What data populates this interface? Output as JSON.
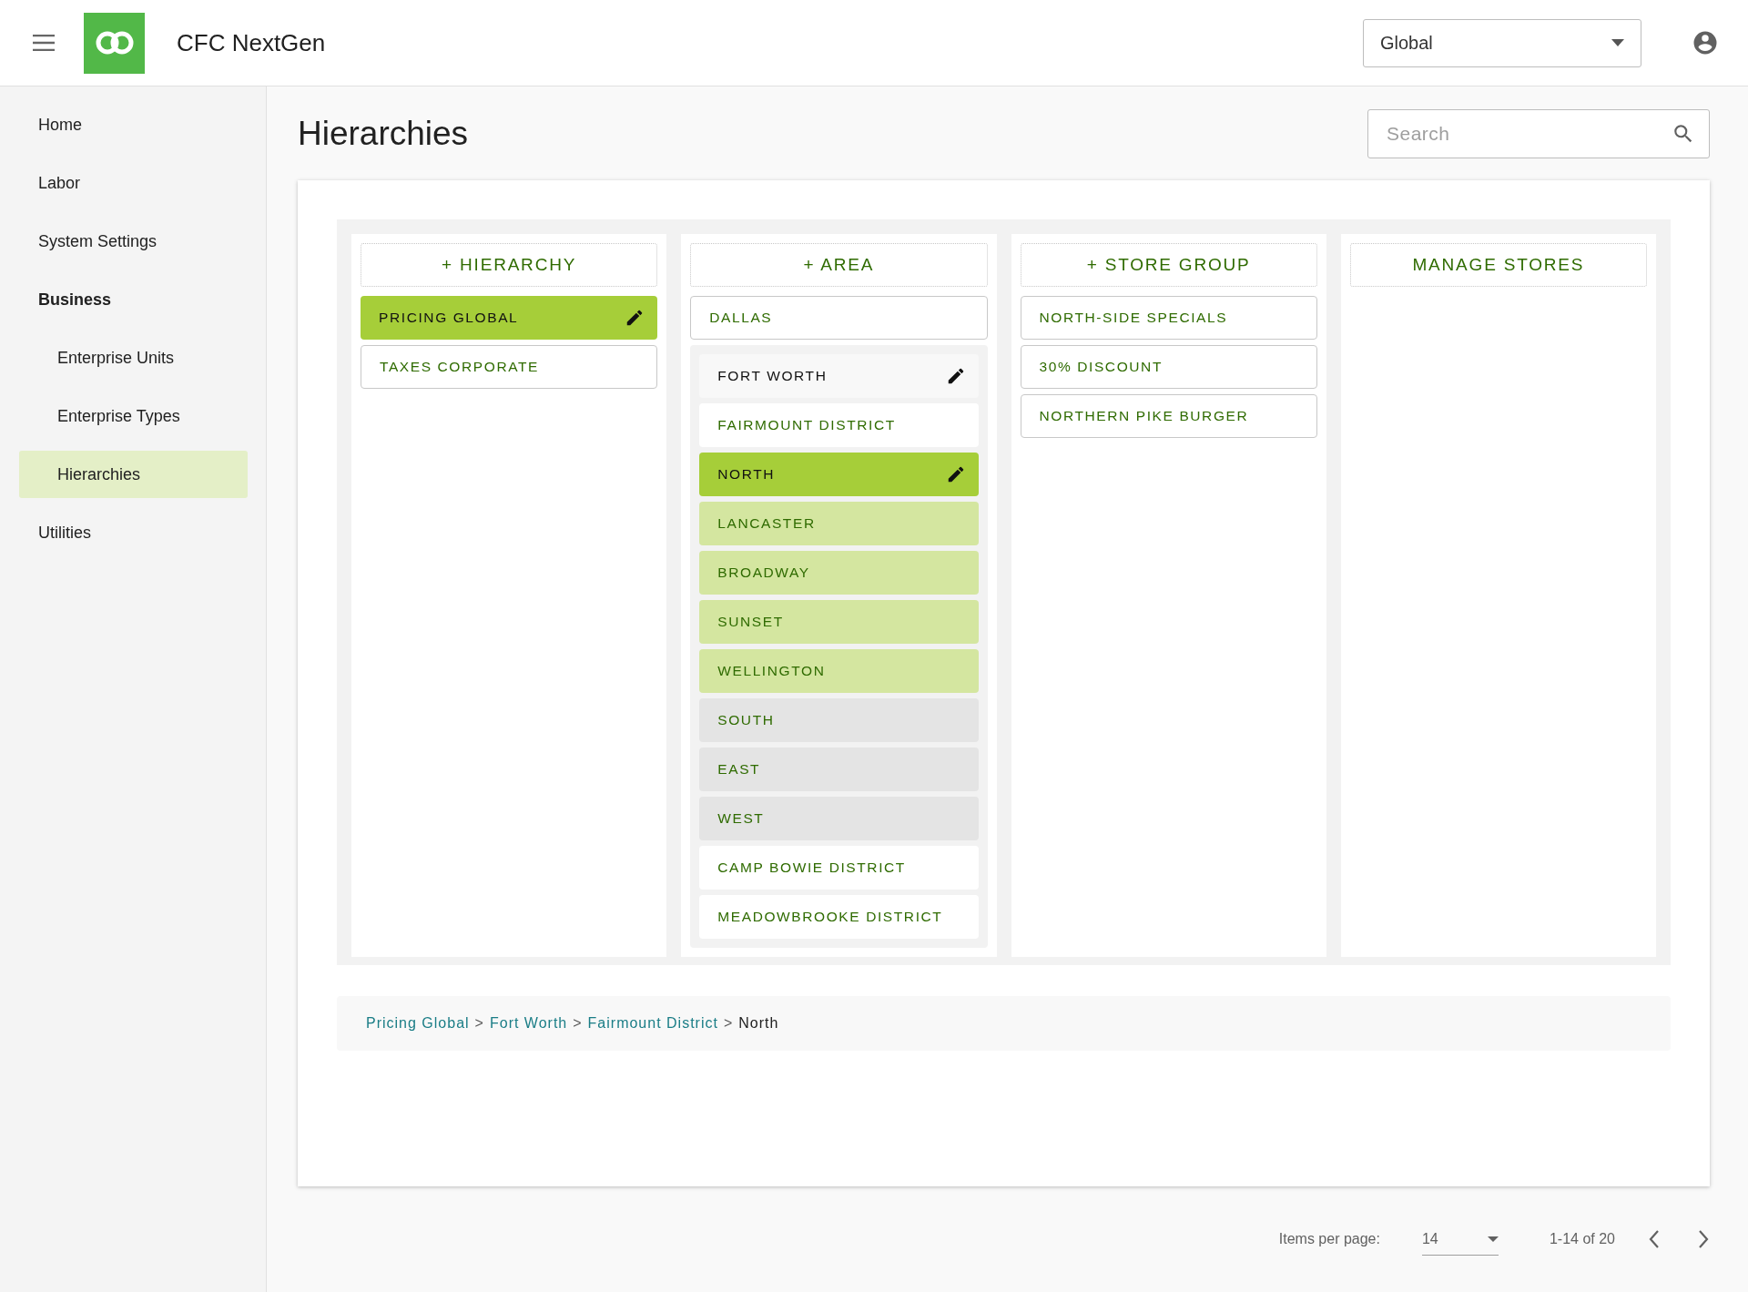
{
  "header": {
    "title": "CFC NextGen",
    "scope_select": {
      "value": "Global"
    }
  },
  "sidebar": {
    "items": [
      {
        "label": "Home",
        "selected": false
      },
      {
        "label": "Labor",
        "selected": false
      },
      {
        "label": "System Settings",
        "selected": false
      },
      {
        "label": "Business",
        "selected": false,
        "children": [
          {
            "label": "Enterprise Units",
            "selected": false
          },
          {
            "label": "Enterprise Types",
            "selected": false
          },
          {
            "label": "Hierarchies",
            "selected": true
          }
        ]
      },
      {
        "label": "Utilities",
        "selected": false
      }
    ]
  },
  "page": {
    "title": "Hierarchies",
    "search": {
      "placeholder": "Search"
    }
  },
  "columns": [
    {
      "header": "+ HIERARCHY",
      "items": [
        {
          "label": "PRICING GLOBAL",
          "selected": true
        },
        {
          "label": "TAXES CORPORATE",
          "selected": false
        }
      ]
    },
    {
      "header": "+ AREA",
      "items": [
        {
          "label": "DALLAS",
          "selected": false
        },
        {
          "label": "FORT WORTH",
          "selected": false,
          "expanded": true,
          "children": [
            {
              "label": "FAIRMOUNT DISTRICT",
              "selected": false,
              "expanded": true,
              "children": [
                {
                  "label": "NORTH",
                  "selected": true,
                  "expanded": true,
                  "children": [
                    {
                      "label": "LANCASTER",
                      "selected": false
                    },
                    {
                      "label": "BROADWAY",
                      "selected": false
                    },
                    {
                      "label": "SUNSET",
                      "selected": false
                    },
                    {
                      "label": "WELLINGTON",
                      "selected": false
                    }
                  ]
                },
                {
                  "label": "SOUTH",
                  "selected": false
                },
                {
                  "label": "EAST",
                  "selected": false
                },
                {
                  "label": "WEST",
                  "selected": false
                }
              ]
            },
            {
              "label": "CAMP BOWIE DISTRICT",
              "selected": false
            },
            {
              "label": "MEADOWBROOKE DISTRICT",
              "selected": false
            }
          ]
        }
      ]
    },
    {
      "header": "+ STORE GROUP",
      "items": [
        {
          "label": "NORTH-SIDE SPECIALS",
          "selected": false
        },
        {
          "label": "30% DISCOUNT",
          "selected": false
        },
        {
          "label": "NORTHERN PIKE BURGER",
          "selected": false
        }
      ]
    },
    {
      "header": "MANAGE STORES"
    }
  ],
  "breadcrumb": [
    {
      "label": "Pricing Global",
      "kind": "link"
    },
    {
      "label": ">",
      "kind": "separator"
    },
    {
      "label": "Fort Worth",
      "kind": "link"
    },
    {
      "label": ">",
      "kind": "separator"
    },
    {
      "label": "Fairmount District",
      "kind": "link"
    },
    {
      "label": ">",
      "kind": "separator"
    },
    {
      "label": "North",
      "kind": "current"
    }
  ],
  "paginator": {
    "label": "Items per page:",
    "page_size": "14",
    "range": "1-14 of 20"
  }
}
